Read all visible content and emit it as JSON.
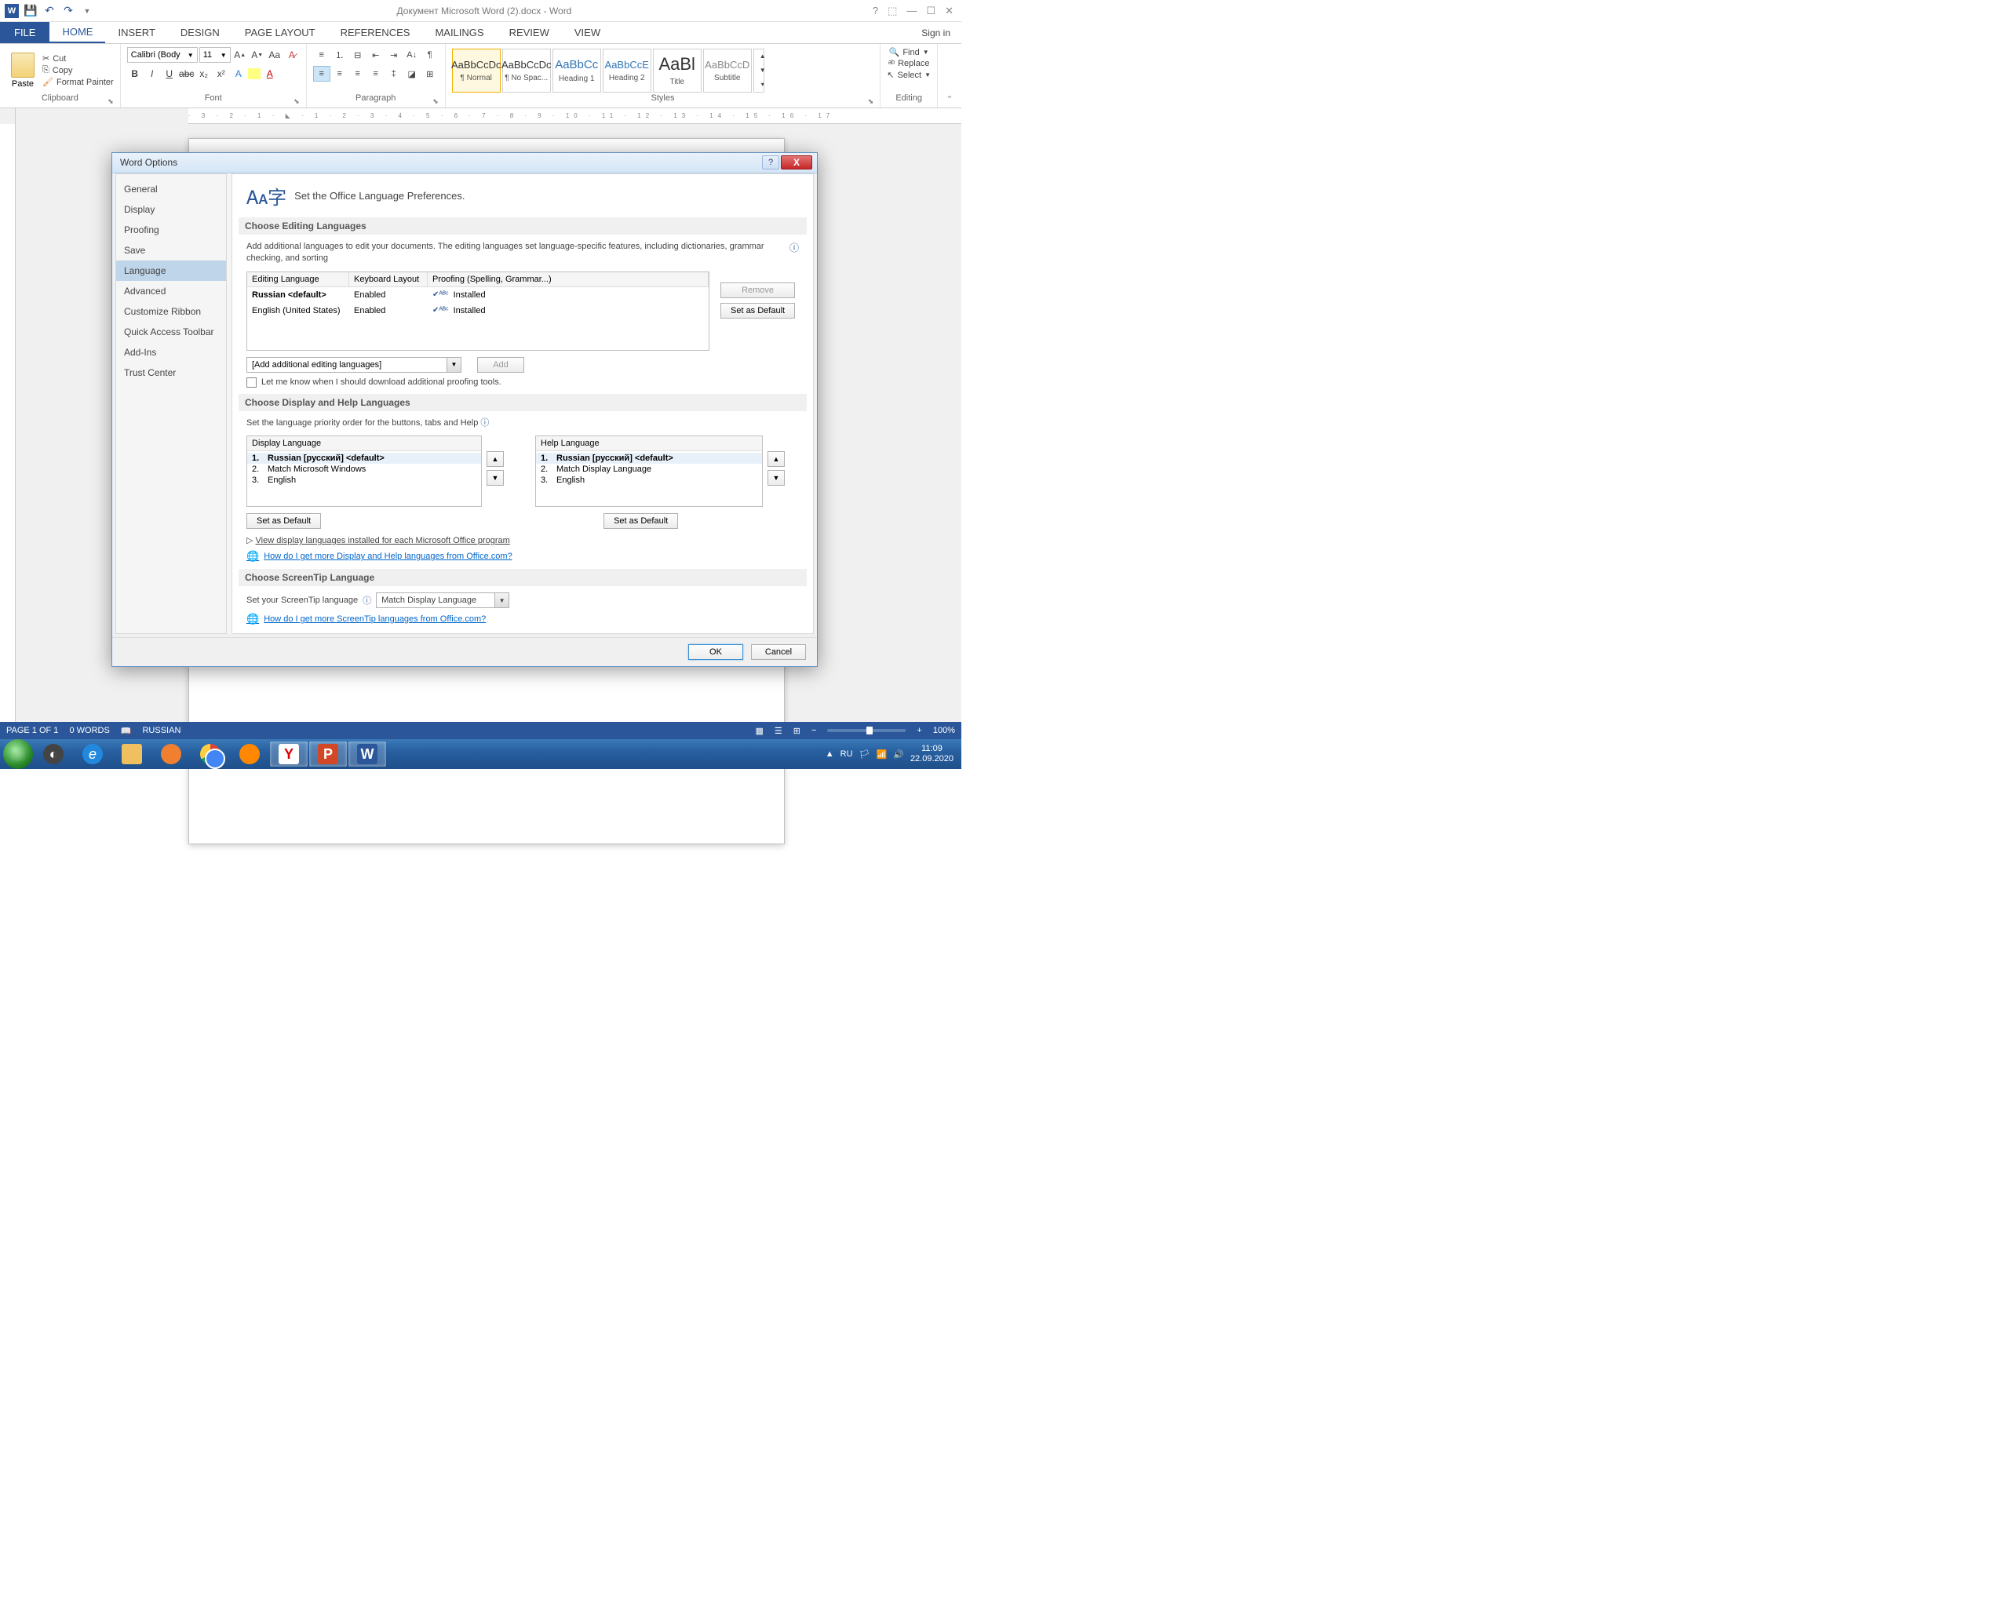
{
  "titlebar": {
    "title": "Документ Microsoft Word (2).docx - Word",
    "signin": "Sign in"
  },
  "ribbon_tabs": {
    "file": "FILE",
    "home": "HOME",
    "insert": "INSERT",
    "design": "DESIGN",
    "page_layout": "PAGE LAYOUT",
    "references": "REFERENCES",
    "mailings": "MAILINGS",
    "review": "REVIEW",
    "view": "VIEW"
  },
  "clipboard": {
    "paste": "Paste",
    "cut": "Cut",
    "copy": "Copy",
    "format_painter": "Format Painter",
    "label": "Clipboard"
  },
  "font": {
    "name": "Calibri (Body",
    "size": "11",
    "label": "Font"
  },
  "paragraph": {
    "label": "Paragraph"
  },
  "styles": {
    "label": "Styles",
    "items": [
      {
        "preview": "AaBbCcDc",
        "name": "¶ Normal"
      },
      {
        "preview": "AaBbCcDc",
        "name": "¶ No Spac..."
      },
      {
        "preview": "AaBbCc",
        "name": "Heading 1"
      },
      {
        "preview": "AaBbCcE",
        "name": "Heading 2"
      },
      {
        "preview": "AaBl",
        "name": "Title"
      },
      {
        "preview": "AaBbCcD",
        "name": "Subtitle"
      }
    ]
  },
  "editing": {
    "find": "Find",
    "replace": "Replace",
    "select": "Select",
    "label": "Editing"
  },
  "dialog": {
    "title": "Word Options",
    "nav": [
      "General",
      "Display",
      "Proofing",
      "Save",
      "Language",
      "Advanced",
      "Customize Ribbon",
      "Quick Access Toolbar",
      "Add-Ins",
      "Trust Center"
    ],
    "nav_active": 4,
    "header": "Set the Office Language Preferences.",
    "sec1": {
      "title": "Choose Editing Languages",
      "desc": "Add additional languages to edit your documents. The editing languages set language-specific features, including dictionaries, grammar checking, and sorting",
      "cols": [
        "Editing Language",
        "Keyboard Layout",
        "Proofing (Spelling, Grammar...)"
      ],
      "rows": [
        {
          "lang": "Russian <default>",
          "kb": "Enabled",
          "proof": "Installed",
          "default": true
        },
        {
          "lang": "English (United States)",
          "kb": "Enabled",
          "proof": "Installed",
          "default": false
        }
      ],
      "remove": "Remove",
      "set_default": "Set as Default",
      "add_combo": "[Add additional editing languages]",
      "add_btn": "Add",
      "check": "Let me know when I should download additional proofing tools."
    },
    "sec2": {
      "title": "Choose Display and Help Languages",
      "desc": "Set the language priority order for the buttons, tabs and Help",
      "display_head": "Display Language",
      "help_head": "Help Language",
      "display_list": [
        "Russian [русский] <default>",
        "Match Microsoft Windows",
        "English"
      ],
      "help_list": [
        "Russian [русский] <default>",
        "Match Display Language",
        "English"
      ],
      "set_default": "Set as Default",
      "expand": "View display languages installed for each Microsoft Office program",
      "link": "How do I get more Display and Help languages from Office.com?"
    },
    "sec3": {
      "title": "Choose ScreenTip Language",
      "desc": "Set your ScreenTip language",
      "combo": "Match Display Language",
      "link": "How do I get more ScreenTip languages from Office.com?"
    },
    "ok": "OK",
    "cancel": "Cancel"
  },
  "statusbar": {
    "page": "PAGE 1 OF 1",
    "words": "0 WORDS",
    "lang": "RUSSIAN",
    "zoom": "100%"
  },
  "taskbar": {
    "lang": "RU",
    "time": "11:09",
    "date": "22.09.2020"
  }
}
